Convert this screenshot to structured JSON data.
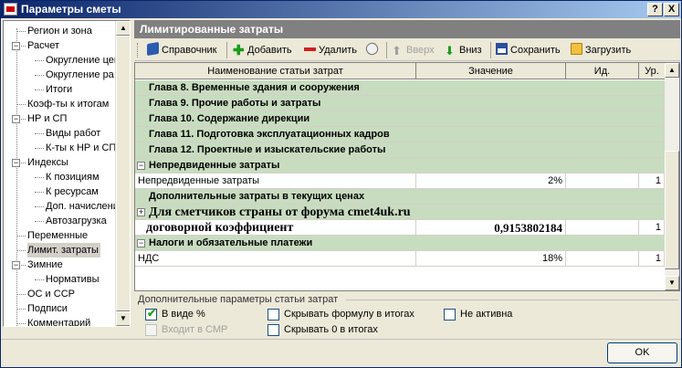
{
  "window": {
    "title": "Параметры сметы",
    "help_btn": "?",
    "close_btn": "X"
  },
  "tree": {
    "items": [
      {
        "label": "Регион и зона",
        "level": 0,
        "box": ""
      },
      {
        "label": "Расчет",
        "level": 0,
        "box": "−"
      },
      {
        "label": "Округление цен",
        "level": 1,
        "box": ""
      },
      {
        "label": "Округление ра",
        "level": 1,
        "box": ""
      },
      {
        "label": "Итоги",
        "level": 1,
        "box": ""
      },
      {
        "label": "Коэф-ты к итогам",
        "level": 0,
        "box": ""
      },
      {
        "label": "НР и СП",
        "level": 0,
        "box": "−"
      },
      {
        "label": "Виды работ",
        "level": 1,
        "box": ""
      },
      {
        "label": "К-ты к НР и СП",
        "level": 1,
        "box": ""
      },
      {
        "label": "Индексы",
        "level": 0,
        "box": "−"
      },
      {
        "label": "К позициям",
        "level": 1,
        "box": ""
      },
      {
        "label": "К ресурсам",
        "level": 1,
        "box": ""
      },
      {
        "label": "Доп. начисления",
        "level": 1,
        "box": ""
      },
      {
        "label": "Автозагрузка",
        "level": 1,
        "box": ""
      },
      {
        "label": "Переменные",
        "level": 0,
        "box": ""
      },
      {
        "label": "Лимит. затраты",
        "level": 0,
        "box": "",
        "selected": true
      },
      {
        "label": "Зимние",
        "level": 0,
        "box": "−"
      },
      {
        "label": "Нормативы",
        "level": 1,
        "box": ""
      },
      {
        "label": "ОС и ССР",
        "level": 0,
        "box": ""
      },
      {
        "label": "Подписи",
        "level": 0,
        "box": ""
      },
      {
        "label": "Комментарий",
        "level": 0,
        "box": ""
      }
    ]
  },
  "panel": {
    "title": "Лимитированные затраты"
  },
  "toolbar": {
    "reference": "Справочник",
    "add": "Добавить",
    "delete": "Удалить",
    "up": "Вверх",
    "down": "Вниз",
    "save": "Сохранить",
    "load": "Загрузить"
  },
  "grid": {
    "headers": [
      "Наименование статьи затрат",
      "Значение",
      "Ид.",
      "Ур."
    ],
    "rows": [
      {
        "name": "Глава 8. Временные здания и сооружения",
        "value": "",
        "id": "",
        "level": "",
        "style": "chapter"
      },
      {
        "name": "Глава 9. Прочие работы и затраты",
        "value": "",
        "id": "",
        "level": "",
        "style": "chapter"
      },
      {
        "name": "Глава 10. Содержание дирекции",
        "value": "",
        "id": "",
        "level": "",
        "style": "chapter"
      },
      {
        "name": "Глава 11. Подготовка эксплуатационных кадров",
        "value": "",
        "id": "",
        "level": "",
        "style": "chapter"
      },
      {
        "name": "Глава 12. Проектные и изыскательские работы",
        "value": "",
        "id": "",
        "level": "",
        "style": "chapter"
      },
      {
        "name": "Непредвиденные затраты",
        "value": "",
        "id": "",
        "level": "",
        "style": "group",
        "box": "−"
      },
      {
        "name": "Непредвиденные затраты",
        "value": "2%",
        "id": "",
        "level": "1",
        "style": "plain"
      },
      {
        "name": "Дополнительные затраты в текущих ценах",
        "value": "",
        "id": "",
        "level": "",
        "style": "chapter"
      },
      {
        "name": "Для сметчиков страны от форума cmet4uk.ru",
        "value": "",
        "id": "",
        "level": "",
        "style": "serif-green",
        "box": "+"
      },
      {
        "name": "договорной коэффициент",
        "value": "0,9153802184",
        "id": "",
        "level": "1",
        "style": "serif-plain"
      },
      {
        "name": "Налоги и обязательные платежи",
        "value": "",
        "id": "",
        "level": "",
        "style": "group",
        "box": "−"
      },
      {
        "name": "НДС",
        "value": "18%",
        "id": "",
        "level": "1",
        "style": "plain"
      }
    ]
  },
  "params": {
    "group_label": "Дополнительные параметры статьи затрат",
    "as_percent": "В виде %",
    "include_smr": "Входит в СМР",
    "hide_formula": "Скрывать формулу в итогах",
    "hide_zero": "Скрывать 0 в итогах",
    "inactive": "Не активна",
    "checkmark": "✔"
  },
  "ok_button": "OK",
  "icons": {
    "collapse": "minus-box-icon",
    "expand": "plus-box-icon"
  }
}
